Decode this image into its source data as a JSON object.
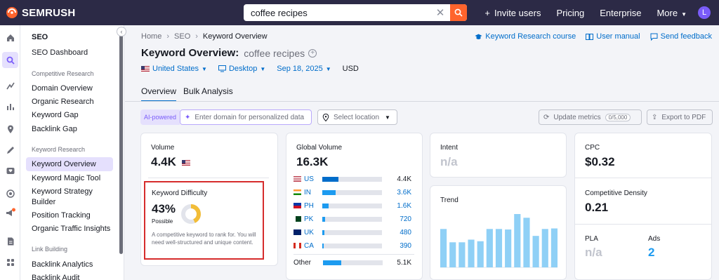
{
  "brand": {
    "name": "SEMRUSH"
  },
  "search": {
    "value": "coffee recipes"
  },
  "topnav": {
    "invite": "Invite users",
    "pricing": "Pricing",
    "enterprise": "Enterprise",
    "more": "More",
    "avatar": "L"
  },
  "sidebar": {
    "title": "SEO",
    "dashboard": "SEO Dashboard",
    "sec_competitive": "Competitive Research",
    "domain_overview": "Domain Overview",
    "organic_research": "Organic Research",
    "keyword_gap": "Keyword Gap",
    "backlink_gap": "Backlink Gap",
    "sec_keyword": "Keyword Research",
    "keyword_overview": "Keyword Overview",
    "keyword_magic": "Keyword Magic Tool",
    "keyword_strategy_1": "Keyword Strategy",
    "keyword_strategy_2": "Builder",
    "position_tracking": "Position Tracking",
    "organic_traffic": "Organic Traffic Insights",
    "sec_link": "Link Building",
    "backlink_analytics": "Backlink Analytics",
    "backlink_audit": "Backlink Audit"
  },
  "breadcrumb": {
    "home": "Home",
    "seo": "SEO",
    "current": "Keyword Overview"
  },
  "links": {
    "course": "Keyword Research course",
    "manual": "User manual",
    "feedback": "Send feedback"
  },
  "page": {
    "title": "Keyword Overview:",
    "keyword": "coffee recipes"
  },
  "filters": {
    "country": "United States",
    "device": "Desktop",
    "date": "Sep 18, 2025",
    "currency": "USD"
  },
  "tabs": {
    "overview": "Overview",
    "bulk": "Bulk Analysis"
  },
  "toolbar": {
    "ai_label": "AI-powered",
    "domain_placeholder": "Enter domain for personalized data",
    "location_placeholder": "Select location",
    "update": "Update metrics",
    "update_count": "0/5,000",
    "export": "Export to PDF"
  },
  "volume": {
    "label": "Volume",
    "value": "4.4K"
  },
  "kd": {
    "label": "Keyword Difficulty",
    "value": "43%",
    "level": "Possible",
    "percent": 43,
    "description": "A competitive keyword to rank for. You will need well-structured and unique content."
  },
  "global_volume": {
    "label": "Global Volume",
    "value": "16.3K",
    "rows": [
      {
        "code": "US",
        "value": "4.4K",
        "share": 0.27
      },
      {
        "code": "IN",
        "value": "3.6K",
        "share": 0.22
      },
      {
        "code": "PH",
        "value": "1.6K",
        "share": 0.1
      },
      {
        "code": "PK",
        "value": "720",
        "share": 0.05
      },
      {
        "code": "UK",
        "value": "480",
        "share": 0.03
      },
      {
        "code": "CA",
        "value": "390",
        "share": 0.025
      }
    ],
    "other_label": "Other",
    "other_value": "5.1K",
    "other_share": 0.31
  },
  "intent": {
    "label": "Intent",
    "value": "n/a"
  },
  "trend": {
    "label": "Trend",
    "values": [
      0.72,
      0.47,
      0.47,
      0.52,
      0.49,
      0.72,
      0.72,
      0.71,
      1.0,
      0.93,
      0.59,
      0.72,
      0.73
    ]
  },
  "cpc": {
    "label": "CPC",
    "value": "$0.32"
  },
  "density": {
    "label": "Competitive Density",
    "value": "0.21"
  },
  "pla": {
    "label": "PLA",
    "value": "n/a"
  },
  "ads": {
    "label": "Ads",
    "value": "2"
  },
  "colors": {
    "topbar": "#2c2a46",
    "accent": "#ff642d",
    "link": "#006dca",
    "purple": "#7a5cfa",
    "kd_ring": "#f2bd38",
    "bar": "#1d9bf0"
  }
}
